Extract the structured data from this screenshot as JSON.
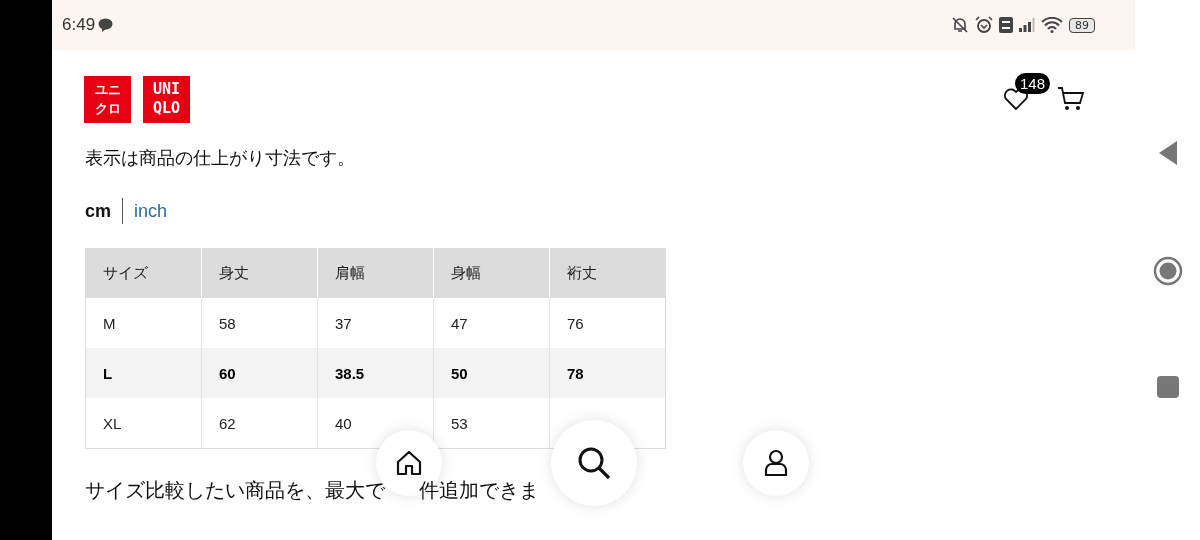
{
  "status_bar": {
    "time": "6:49",
    "battery": "89"
  },
  "header": {
    "logo_katakana": [
      "ユニ",
      "クロ"
    ],
    "logo_latin": [
      "UNI",
      "QLO"
    ],
    "wishlist_count": "148"
  },
  "note": "表示は商品の仕上がり寸法です。",
  "units": [
    {
      "label": "cm",
      "selected": true
    },
    {
      "label": "inch",
      "selected": false
    }
  ],
  "table": {
    "columns": [
      "サイズ",
      "身丈",
      "肩幅",
      "身幅",
      "裄丈"
    ],
    "rows": [
      {
        "cells": [
          "M",
          "58",
          "37",
          "47",
          "76"
        ],
        "selected": false
      },
      {
        "cells": [
          "L",
          "60",
          "38.5",
          "50",
          "78"
        ],
        "selected": true
      },
      {
        "cells": [
          "XL",
          "62",
          "40",
          "53"
        ],
        "selected": false
      }
    ]
  },
  "footer_text": [
    "サイズ比較したい商品を、最大で",
    "件追加できま"
  ]
}
